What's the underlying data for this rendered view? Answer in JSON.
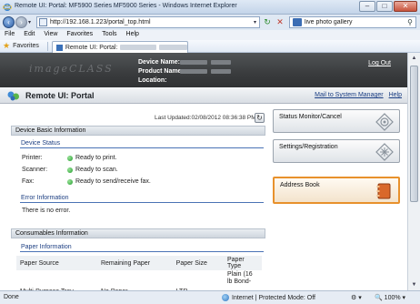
{
  "window": {
    "title": "Remote UI: Portal: MF5900 Series MF5900 Series - Windows Internet Explorer",
    "minimize": "–",
    "maximize": "□",
    "close": "✕"
  },
  "addressbar": {
    "url": "http://192.168.1.223/portal_top.html",
    "search_value": "live photo gallery"
  },
  "menu": [
    "File",
    "Edit",
    "View",
    "Favorites",
    "Tools",
    "Help"
  ],
  "favorites": {
    "label": "Favorites",
    "tab_title": "Remote UI: Portal:"
  },
  "header": {
    "logo": "imageCLASS",
    "device_name_label": "Device Name:",
    "product_name_label": "Product Name:",
    "location_label": "Location:",
    "logout": "Log Out"
  },
  "portal": {
    "title": "Remote UI: Portal",
    "mail_link": "Mail to System Manager",
    "help_link": "Help",
    "last_updated": "Last Updated:02/08/2012 08:36:38 PM"
  },
  "device_basic": {
    "section_title": "Device Basic Information",
    "status_heading": "Device Status",
    "rows": [
      {
        "label": "Printer:",
        "value": "Ready to print."
      },
      {
        "label": "Scanner:",
        "value": "Ready to scan."
      },
      {
        "label": "Fax:",
        "value": "Ready to send/receive fax."
      }
    ],
    "error_heading": "Error Information",
    "error_text": "There is no error."
  },
  "consumables": {
    "section_title": "Consumables Information",
    "paper_heading": "Paper Information",
    "columns": [
      "Paper Source",
      "Remaining Paper",
      "Paper Size",
      "Paper Type"
    ],
    "rows": [
      [
        "Multi-Purpose Tray",
        "No Paper",
        "LTR",
        "Plain (16 lb Bond-"
      ]
    ]
  },
  "sidebar": {
    "status_monitor": "Status Monitor/Cancel",
    "settings": "Settings/Registration",
    "address_book": "Address Book"
  },
  "statusbar": {
    "left": "Done",
    "zone": "Internet | Protected Mode: Off",
    "zoom": "100%"
  },
  "colors": {
    "header_band": "#3a3c3e",
    "highlight_border": "#e8912c",
    "link": "#1a3e84",
    "status_green": "#1f9a2a"
  }
}
